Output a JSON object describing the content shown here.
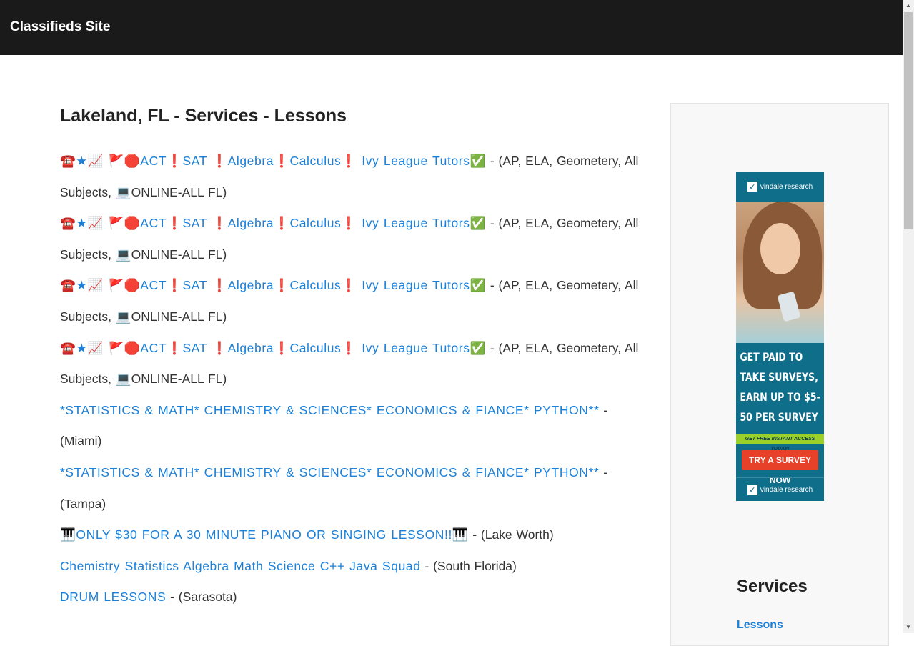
{
  "header": {
    "site_title": "Classifieds Site"
  },
  "main": {
    "title": "Lakeland, FL - Services - Lessons",
    "listings": [
      {
        "title": "☎️★📈 🚩🛑ACT❗SAT ❗Algebra❗Calculus❗ Ivy League Tutors✅",
        "location": " - (AP, ELA, Geometery, All Subjects, 💻ONLINE-ALL FL)"
      },
      {
        "title": "☎️★📈 🚩🛑ACT❗SAT ❗Algebra❗Calculus❗ Ivy League Tutors✅",
        "location": " - (AP, ELA, Geometery, All Subjects, 💻ONLINE-ALL FL)"
      },
      {
        "title": "☎️★📈 🚩🛑ACT❗SAT ❗Algebra❗Calculus❗ Ivy League Tutors✅",
        "location": " - (AP, ELA, Geometery, All Subjects, 💻ONLINE-ALL FL)"
      },
      {
        "title": "☎️★📈 🚩🛑ACT❗SAT ❗Algebra❗Calculus❗ Ivy League Tutors✅",
        "location": " - (AP, ELA, Geometery, All Subjects, 💻ONLINE-ALL FL)"
      },
      {
        "title": "*STATISTICS & MATH* CHEMISTRY & SCIENCES* ECONOMICS & FIANCE* PYTHON**",
        "location": " - (Miami)"
      },
      {
        "title": "*STATISTICS & MATH* CHEMISTRY & SCIENCES* ECONOMICS & FIANCE* PYTHON**",
        "location": " - (Tampa)"
      },
      {
        "title": "🎹ONLY $30 FOR A 30 MINUTE PIANO OR SINGING LESSON!!🎹",
        "location": " - (Lake Worth)"
      },
      {
        "title": "Chemistry Statistics Algebra Math Science C++ Java Squad",
        "location": " - (South Florida)"
      },
      {
        "title": "DRUM LESSONS",
        "location": " - (Sarasota)"
      }
    ]
  },
  "ad": {
    "brand_top": "vindale research",
    "headline": "GET PAID TO TAKE SURVEYS, EARN UP TO $5-50 PER SURVEY",
    "strip": "GET FREE INSTANT ACCESS TODAY!",
    "cta": "TRY A SURVEY NOW",
    "brand_bottom": "vindale research",
    "colors": {
      "background": "#0f6e8a",
      "strip": "#9bd02b",
      "cta": "#e8412a"
    }
  },
  "sidebar": {
    "heading": "Services",
    "link": "Lessons"
  },
  "colors": {
    "link": "#1a80d9",
    "header_bg": "#1a1a1a"
  }
}
